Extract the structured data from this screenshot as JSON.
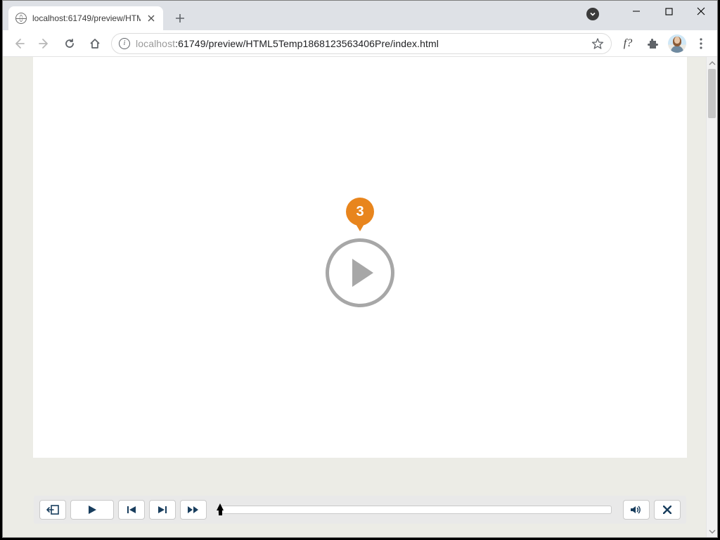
{
  "window": {
    "tab_title": "localhost:61749/preview/HTML5T",
    "url_host": "localhost",
    "url_rest": ":61749/preview/HTML5Temp1868123563406Pre/index.html"
  },
  "marker": {
    "label": "3"
  },
  "playbar": {
    "exit_label": "Exit",
    "play_label": "Play",
    "prev_label": "Previous",
    "next_label": "Next",
    "ff_label": "Fast Forward",
    "volume_label": "Volume",
    "close_label": "Close Captions"
  }
}
